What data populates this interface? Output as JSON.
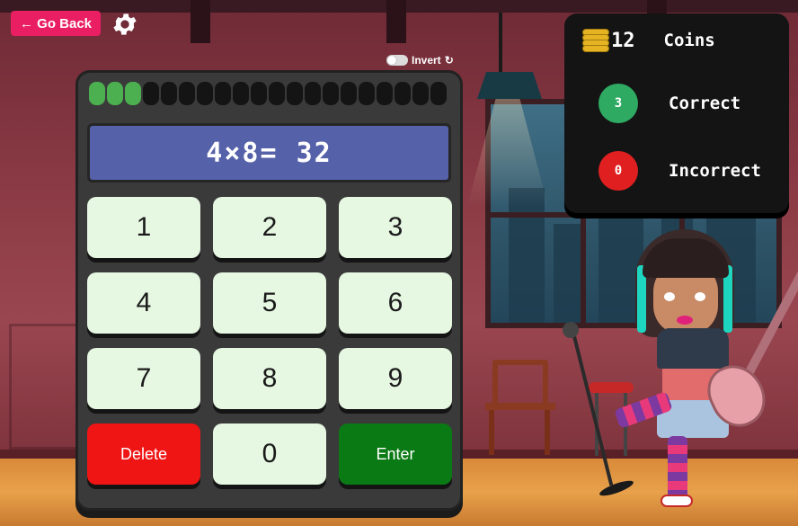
{
  "nav": {
    "back_label": "← Go Back",
    "settings_icon": "gear-icon"
  },
  "invert": {
    "label": "Invert",
    "on": false,
    "icon": "refresh-icon"
  },
  "progress": {
    "completed": 3,
    "total": 20,
    "done_color": "#4caf50"
  },
  "problem": {
    "text": "4×8= 32"
  },
  "keypad": {
    "keys": [
      "1",
      "2",
      "3",
      "4",
      "5",
      "6",
      "7",
      "8",
      "9"
    ],
    "delete_label": "Delete",
    "zero_label": "0",
    "enter_label": "Enter"
  },
  "scoreboard": {
    "coins_value": "12",
    "coins_label": "Coins",
    "correct_value": "3",
    "correct_label": "Correct",
    "correct_color": "#2eaa63",
    "incorrect_value": "0",
    "incorrect_label": "Incorrect",
    "incorrect_color": "#e02020"
  },
  "colors": {
    "accent": "#e91e63",
    "delete": "#f01515",
    "enter": "#0a7a14",
    "display": "#5561a8"
  }
}
